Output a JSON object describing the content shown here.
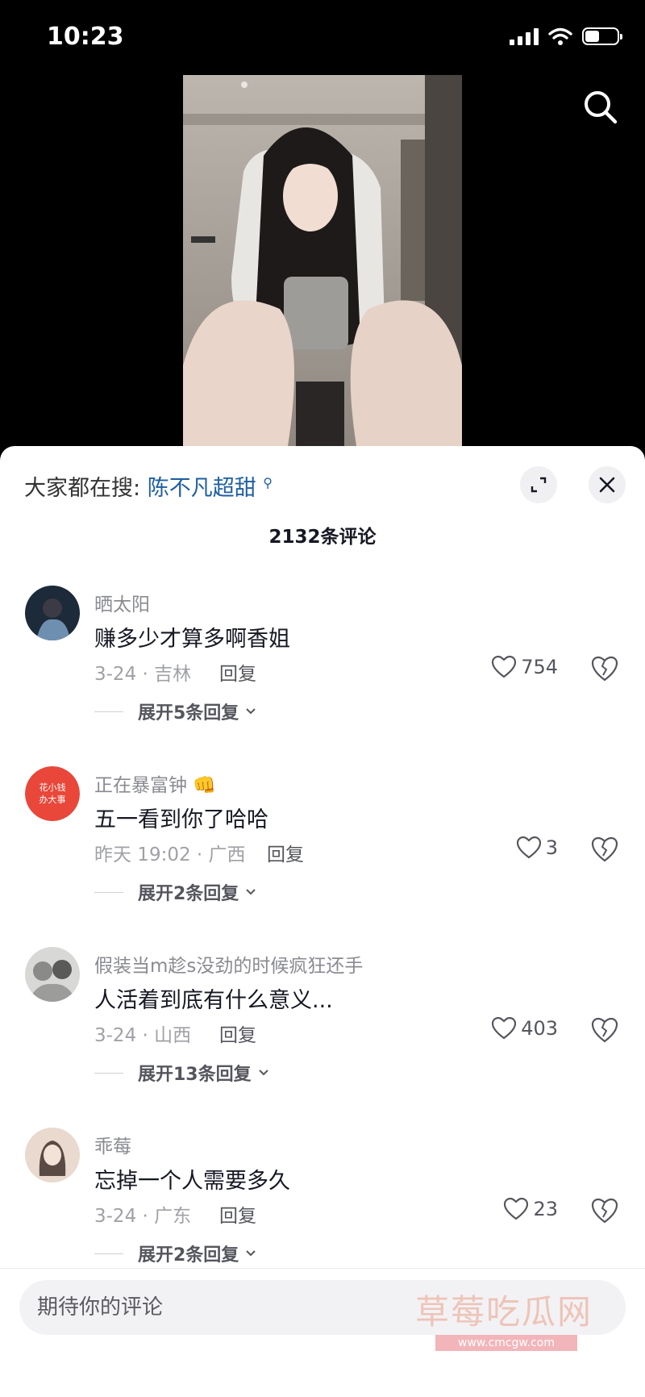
{
  "status_bar": {
    "time": "10:23",
    "battery_level": 0.45
  },
  "hot_search": {
    "prefix": "大家都在搜:",
    "term": "陈不凡超甜"
  },
  "comment_count": "2132条评论",
  "comments": [
    {
      "user": "晒太阳",
      "text": "赚多少才算多啊香姐",
      "date_location": "3-24 · 吉林",
      "reply": "回复",
      "likes": "754",
      "expand": "展开5条回复"
    },
    {
      "user": "正在暴富钟",
      "text": "五一看到你了哈哈",
      "date_location": "昨天 19:02 · 广西",
      "reply": "回复",
      "likes": "3",
      "expand": "展开2条回复",
      "avatar_text": [
        "花小钱",
        "办大事"
      ]
    },
    {
      "user": "假装当m趁s没劲的时候疯狂还手",
      "text": "人活着到底有什么意义...",
      "date_location": "3-24 · 山西",
      "reply": "回复",
      "likes": "403",
      "expand": "展开13条回复"
    },
    {
      "user": "乖莓",
      "text": "忘掉一个人需要多久",
      "date_location": "3-24 · 广东",
      "reply": "回复",
      "likes": "23",
      "expand": "展开2条回复"
    }
  ],
  "comment_input": {
    "placeholder": "期待你的评论"
  },
  "watermark": {
    "title": "草莓吃瓜网",
    "url": "www.cmcgw.com"
  },
  "colors": {
    "link": "#1f5fa0",
    "sheet_bg": "#ffffff",
    "screen_bg": "#000000"
  }
}
